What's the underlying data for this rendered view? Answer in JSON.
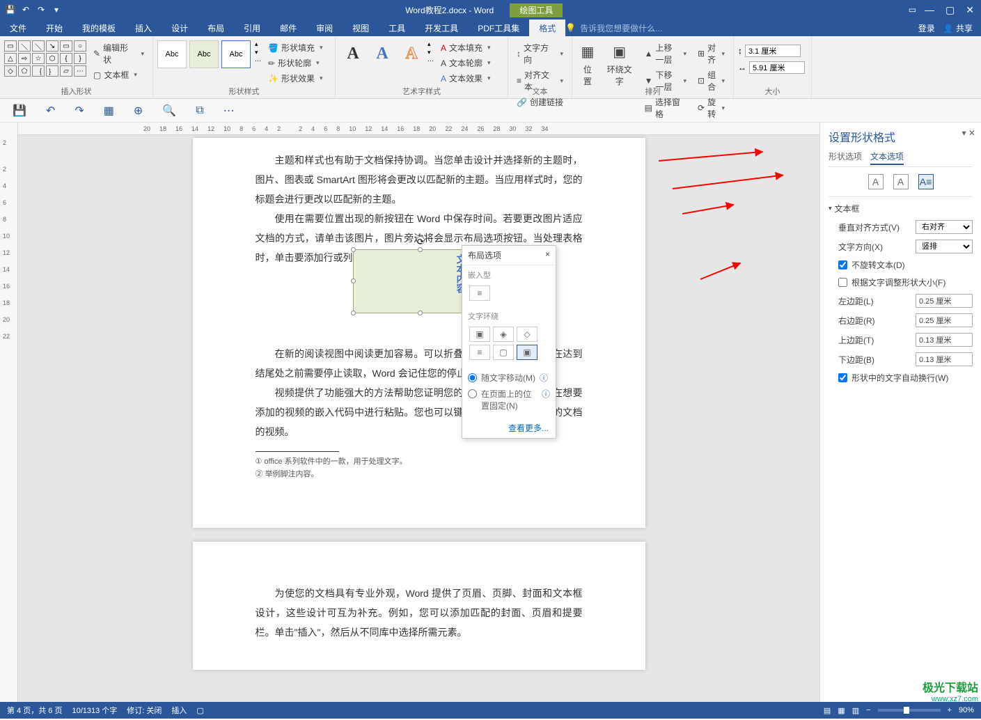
{
  "title": {
    "doc": "Word教程2.docx - Word",
    "ctx_tool": "绘图工具"
  },
  "win": {
    "login": "登录",
    "share": "共享"
  },
  "tabs": [
    "文件",
    "开始",
    "我的模板",
    "插入",
    "设计",
    "布局",
    "引用",
    "邮件",
    "审阅",
    "视图",
    "工具",
    "开发工具",
    "PDF工具集",
    "格式"
  ],
  "tell_me": "告诉我您想要做什么...",
  "ribbon": {
    "g1": {
      "edit_shape": "编辑形状",
      "textbox": "文本框",
      "label": "插入形状"
    },
    "g2": {
      "style1": "Abc",
      "style2": "Abc",
      "style3": "Abc",
      "fill": "形状填充",
      "outline": "形状轮廓",
      "effects": "形状效果",
      "label": "形状样式"
    },
    "g3": {
      "label": "艺术字样式",
      "a_fill": "文本填充",
      "a_outline": "文本轮廓",
      "a_effects": "文本效果"
    },
    "g4": {
      "dir": "文字方向",
      "align": "对齐文本",
      "link": "创建链接",
      "label": "文本"
    },
    "g5": {
      "pos": "位置",
      "wrap": "环绕文字",
      "up": "上移一层",
      "down": "下移一层",
      "sel": "选择窗格",
      "al": "对齐",
      "grp": "组合",
      "rot": "旋转",
      "label": "排列"
    },
    "g6": {
      "h": "3.1 厘米",
      "w": "5.91 厘米",
      "label": "大小"
    }
  },
  "hruler": [
    "20",
    "18",
    "16",
    "14",
    "12",
    "10",
    "8",
    "6",
    "4",
    "2",
    "",
    "2",
    "4",
    "6",
    "8",
    "10",
    "12",
    "14",
    "16",
    "18",
    "20",
    "22",
    "24",
    "26",
    "28",
    "30",
    "32",
    "34"
  ],
  "vruler": [
    "2",
    "",
    "2",
    "4",
    "6",
    "8",
    "10",
    "12",
    "14",
    "16",
    "18",
    "20",
    "22"
  ],
  "vruler2": [
    "2",
    "",
    "2"
  ],
  "doc": {
    "p1": "主题和样式也有助于文档保持协调。当您单击设计并选择新的主题时，图片、图表或 SmartArt 图形将会更改以匹配新的主题。当应用样式时，您的标题会进行更改以匹配新的主题。",
    "p2": "使用在需要位置出现的新按钮在 Word 中保存时间。若要更改图片适应文档的方式，请单击该图片，图片旁边将会显示布局选项按钮。当处理表格时，单击要添加行或列的位置，然后单击加号。",
    "tb_text": "这里是举例文本内容。",
    "p3": "在新的阅读视图中阅读更加容易。可以折叠文档某些部分并如果在达到结尾处之前需要停止读取，Word 会记住您的停止位置一个设备上。",
    "p4": "视频提供了功能强大的方法帮助您证明您的观点。当您单击联机在想要添加的视频的嵌入代码中进行粘贴。您也可以键入一个关键最适合您的文档的视频。",
    "fn1": "office 系列软件中的一款，用于处理文字。",
    "fn2": "举例脚注内容。",
    "p5": "为使您的文档具有专业外观，Word 提供了页眉、页脚、封面和文本框设计，这些设计可互为补充。例如，您可以添加匹配的封面、页眉和提要栏。单击\"插入\"，然后从不同库中选择所需元素。"
  },
  "layout_popup": {
    "title": "布局选项",
    "close": "×",
    "embed": "嵌入型",
    "wrap": "文字环绕",
    "r1": "随文字移动(M)",
    "r2": "在页面上的位置固定(N)",
    "more": "查看更多..."
  },
  "pane": {
    "title": "设置形状格式",
    "tab1": "形状选项",
    "tab2": "文本选项",
    "section": "文本框",
    "valign_l": "垂直对齐方式(V)",
    "valign_v": "右对齐",
    "dir_l": "文字方向(X)",
    "dir_v": "竖排",
    "norot": "不旋转文本(D)",
    "autofit": "根据文字调整形状大小(F)",
    "ml_l": "左边距(L)",
    "ml_v": "0.25 厘米",
    "mr_l": "右边距(R)",
    "mr_v": "0.25 厘米",
    "mt_l": "上边距(T)",
    "mt_v": "0.13 厘米",
    "mb_l": "下边距(B)",
    "mb_v": "0.13 厘米",
    "autowrap": "形状中的文字自动换行(W)"
  },
  "status": {
    "page": "第 4 页，共 6 页",
    "words": "10/1313 个字",
    "track": "修订: 关闭",
    "insert": "插入",
    "zoom": "90%"
  },
  "watermark": {
    "logo": "极光下载站",
    "url": "www.xz7.com"
  }
}
